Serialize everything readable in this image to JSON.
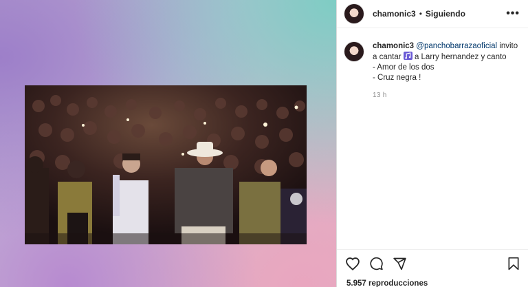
{
  "post": {
    "username": "chamonic3",
    "separator": "•",
    "follow_status": "Siguiendo",
    "more_icon": "more-icon",
    "caption": {
      "username": "chamonic3",
      "mention": "@panchobarrazaoficial",
      "text_1": " invito a cantar ",
      "music_icon": "music-note-icon",
      "text_2": " a Larry hernandez y canto",
      "line_2": "- Amor de los dos",
      "line_3": "- Cruz negra !"
    },
    "time_ago": "13 h",
    "views": "5.957 reproducciones"
  },
  "icons": [
    "heart-icon",
    "comment-icon",
    "share-icon",
    "bookmark-icon"
  ],
  "colors": {
    "text": "#262626",
    "mention": "#00376b",
    "secondary": "#8e8e8e",
    "border": "#dbdbdb"
  }
}
